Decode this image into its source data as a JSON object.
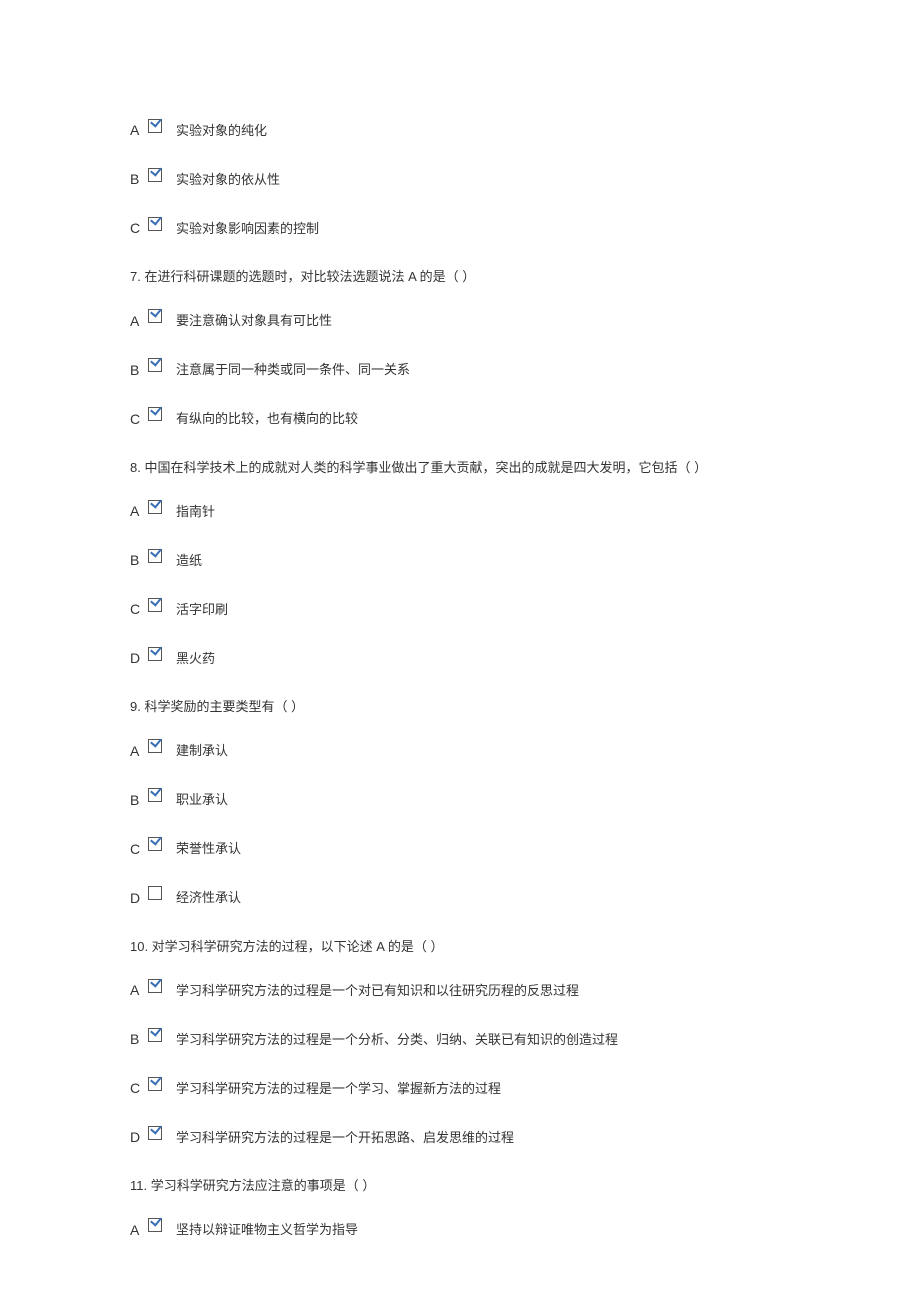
{
  "blocks": [
    {
      "type": "option",
      "letter": "A",
      "checked": true,
      "text": "实验对象的纯化"
    },
    {
      "type": "option",
      "letter": "B",
      "checked": true,
      "text": "实验对象的依从性"
    },
    {
      "type": "option",
      "letter": "C",
      "checked": true,
      "text": "实验对象影响因素的控制"
    },
    {
      "type": "question",
      "text": "7.  在进行科研课题的选题时，对比较法选题说法 A 的是（ ）"
    },
    {
      "type": "option",
      "letter": "A",
      "checked": true,
      "text": "要注意确认对象具有可比性"
    },
    {
      "type": "option",
      "letter": "B",
      "checked": true,
      "text": "注意属于同一种类或同一条件、同一关系"
    },
    {
      "type": "option",
      "letter": "C",
      "checked": true,
      "text": "有纵向的比较，也有横向的比较"
    },
    {
      "type": "question",
      "text": "8.  中国在科学技术上的成就对人类的科学事业做出了重大贡献，突出的成就是四大发明，它包括（ ）"
    },
    {
      "type": "option",
      "letter": "A",
      "checked": true,
      "text": "指南针"
    },
    {
      "type": "option",
      "letter": "B",
      "checked": true,
      "text": "造纸"
    },
    {
      "type": "option",
      "letter": "C",
      "checked": true,
      "text": "活字印刷"
    },
    {
      "type": "option",
      "letter": "D",
      "checked": true,
      "text": "黑火药"
    },
    {
      "type": "question",
      "text": "9.  科学奖励的主要类型有（ ）"
    },
    {
      "type": "option",
      "letter": "A",
      "checked": true,
      "text": "建制承认"
    },
    {
      "type": "option",
      "letter": "B",
      "checked": true,
      "text": "职业承认"
    },
    {
      "type": "option",
      "letter": "C",
      "checked": true,
      "text": "荣誉性承认"
    },
    {
      "type": "option",
      "letter": "D",
      "checked": false,
      "text": "经济性承认"
    },
    {
      "type": "question",
      "text": "10.  对学习科学研究方法的过程，以下论述 A 的是（ ）"
    },
    {
      "type": "option",
      "letter": "A",
      "checked": true,
      "text": "学习科学研究方法的过程是一个对已有知识和以往研究历程的反思过程"
    },
    {
      "type": "option",
      "letter": "B",
      "checked": true,
      "text": "学习科学研究方法的过程是一个分析、分类、归纳、关联已有知识的创造过程"
    },
    {
      "type": "option",
      "letter": "C",
      "checked": true,
      "text": "学习科学研究方法的过程是一个学习、掌握新方法的过程"
    },
    {
      "type": "option",
      "letter": "D",
      "checked": true,
      "text": "学习科学研究方法的过程是一个开拓思路、启发思维的过程"
    },
    {
      "type": "question",
      "text": "11.  学习科学研究方法应注意的事项是（ ）"
    },
    {
      "type": "option",
      "letter": "A",
      "checked": true,
      "text": "坚持以辩证唯物主义哲学为指导"
    }
  ]
}
